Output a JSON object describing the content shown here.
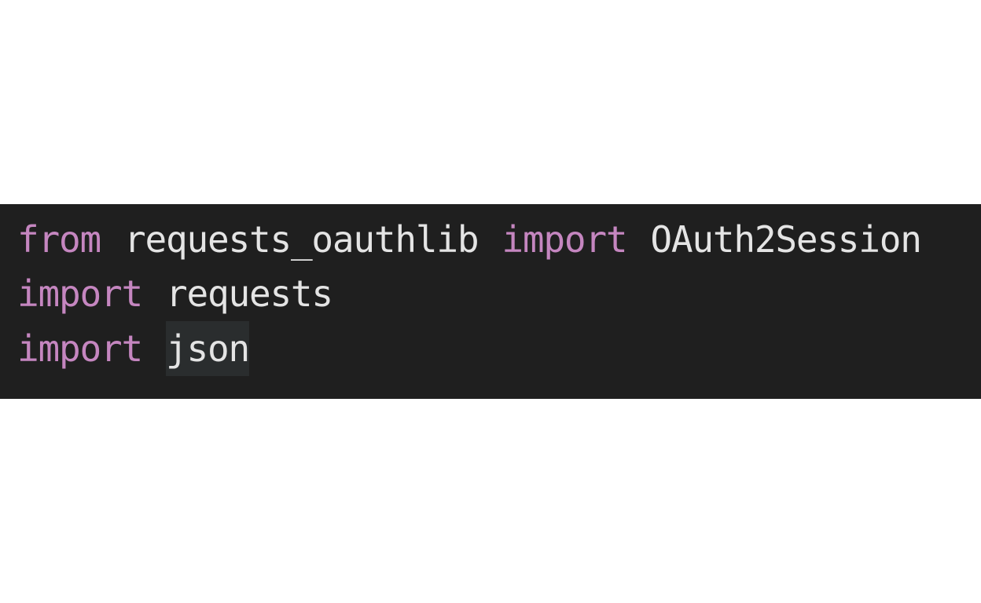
{
  "editor": {
    "colors": {
      "background": "#1f1f1f",
      "keyword": "#c586c0",
      "text": "#e4e4e4",
      "highlight": "#2a2d2e"
    },
    "lines": [
      {
        "keyword1": "from",
        "module": "requests_oauthlib",
        "keyword2": "import",
        "name": "OAuth2Session"
      },
      {
        "keyword": "import",
        "module": "requests"
      },
      {
        "keyword": "import",
        "module": "json"
      }
    ]
  }
}
